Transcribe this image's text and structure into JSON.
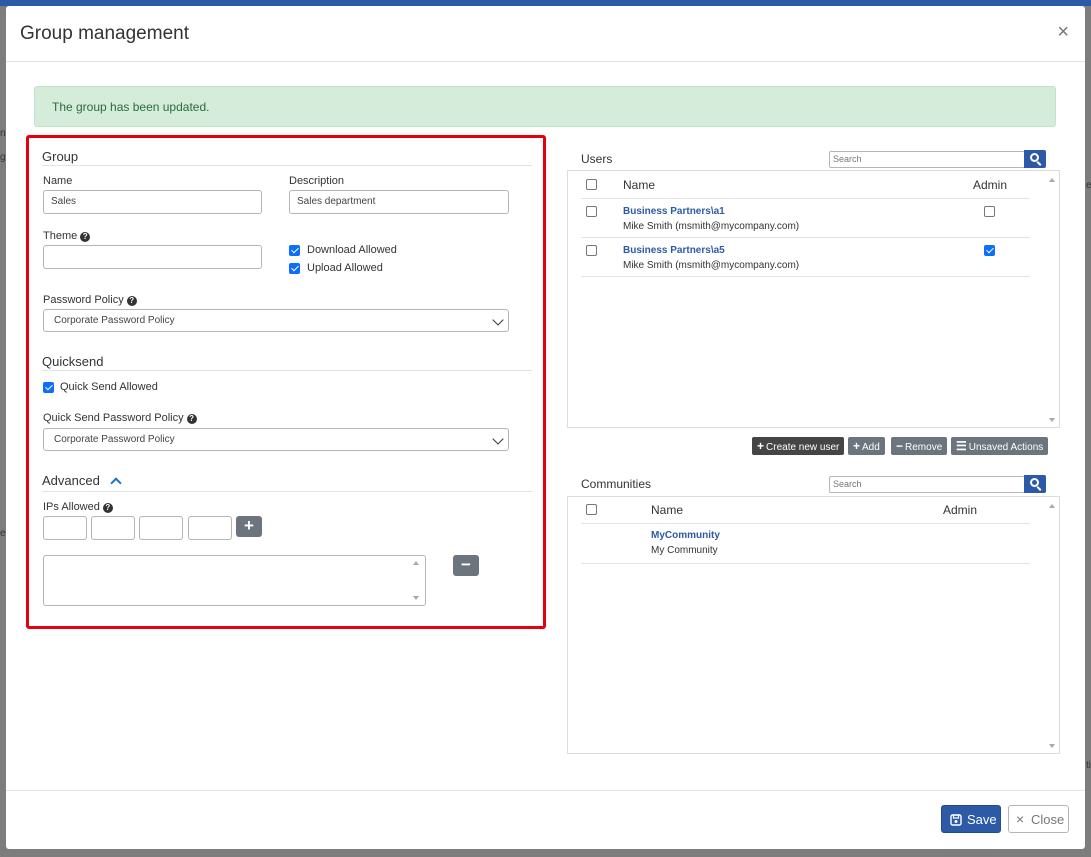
{
  "dialog": {
    "title": "Group management",
    "close_glyph": "×",
    "alert": "The group has been updated."
  },
  "group": {
    "section_title": "Group",
    "name_label": "Name",
    "name_value": "Sales",
    "description_label": "Description",
    "description_value": "Sales department",
    "theme_label": "Theme",
    "theme_value": "",
    "download_allowed_label": "Download Allowed",
    "download_allowed": true,
    "upload_allowed_label": "Upload Allowed",
    "upload_allowed": true,
    "password_policy_label": "Password Policy",
    "password_policy_value": "Corporate Password Policy"
  },
  "quicksend": {
    "section_title": "Quicksend",
    "allowed_label": "Quick Send Allowed",
    "allowed": true,
    "password_policy_label": "Quick Send Password Policy",
    "password_policy_value": "Corporate Password Policy"
  },
  "advanced": {
    "section_title": "Advanced",
    "ips_label": "IPs Allowed",
    "add_glyph": "+",
    "remove_glyph": "−"
  },
  "users": {
    "title": "Users",
    "search_placeholder": "Search",
    "col_name": "Name",
    "col_admin": "Admin",
    "rows": [
      {
        "name": "Business Partners\\a1",
        "detail": "Mike Smith (msmith@mycompany.com)",
        "admin": false
      },
      {
        "name": "Business Partners\\a5",
        "detail": "Mike Smith (msmith@mycompany.com)",
        "admin": true
      }
    ],
    "buttons": {
      "create": "Create new user",
      "add": "Add",
      "remove": "Remove",
      "unsaved": "Unsaved Actions"
    }
  },
  "communities": {
    "title": "Communities",
    "search_placeholder": "Search",
    "col_name": "Name",
    "col_admin": "Admin",
    "rows": [
      {
        "name": "MyCommunity",
        "detail": "My Community"
      }
    ]
  },
  "footer": {
    "save": "Save",
    "close": "Close"
  },
  "colors": {
    "primary": "#2d5aa6",
    "highlight_border": "#e3000f",
    "alert_bg": "#d5ecdb",
    "checkbox": "#0d6efd"
  }
}
